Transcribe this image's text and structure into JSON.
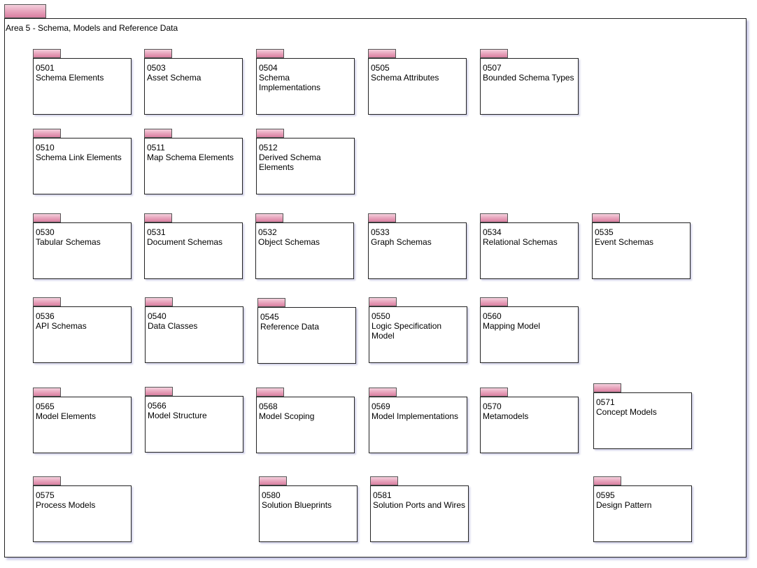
{
  "area_title": "Area 5 - Schema, Models and Reference Data",
  "packages": [
    {
      "id": "0501",
      "name": "Schema Elements"
    },
    {
      "id": "0503",
      "name": "Asset Schema"
    },
    {
      "id": "0504",
      "name": "Schema Implementations"
    },
    {
      "id": "0505",
      "name": "Schema Attributes"
    },
    {
      "id": "0507",
      "name": "Bounded Schema Types"
    },
    {
      "id": "0510",
      "name": "Schema Link Elements"
    },
    {
      "id": "0511",
      "name": "Map Schema Elements"
    },
    {
      "id": "0512",
      "name": "Derived Schema Elements"
    },
    {
      "id": "0530",
      "name": "Tabular Schemas"
    },
    {
      "id": "0531",
      "name": "Document Schemas"
    },
    {
      "id": "0532",
      "name": "Object Schemas"
    },
    {
      "id": "0533",
      "name": "Graph Schemas"
    },
    {
      "id": "0534",
      "name": "Relational Schemas"
    },
    {
      "id": "0535",
      "name": "Event Schemas"
    },
    {
      "id": "0536",
      "name": "API Schemas"
    },
    {
      "id": "0540",
      "name": "Data Classes"
    },
    {
      "id": "0545",
      "name": "Reference Data"
    },
    {
      "id": "0550",
      "name": "Logic Specification Model"
    },
    {
      "id": "0560",
      "name": "Mapping Model"
    },
    {
      "id": "0565",
      "name": "Model Elements"
    },
    {
      "id": "0566",
      "name": "Model Structure"
    },
    {
      "id": "0568",
      "name": "Model Scoping"
    },
    {
      "id": "0569",
      "name": "Model Implementations"
    },
    {
      "id": "0570",
      "name": "Metamodels"
    },
    {
      "id": "0571",
      "name": "Concept Models"
    },
    {
      "id": "0575",
      "name": "Process Models"
    },
    {
      "id": "0580",
      "name": "Solution Blueprints"
    },
    {
      "id": "0581",
      "name": "Solution Ports and Wires"
    },
    {
      "id": "0595",
      "name": "Design Pattern"
    }
  ]
}
